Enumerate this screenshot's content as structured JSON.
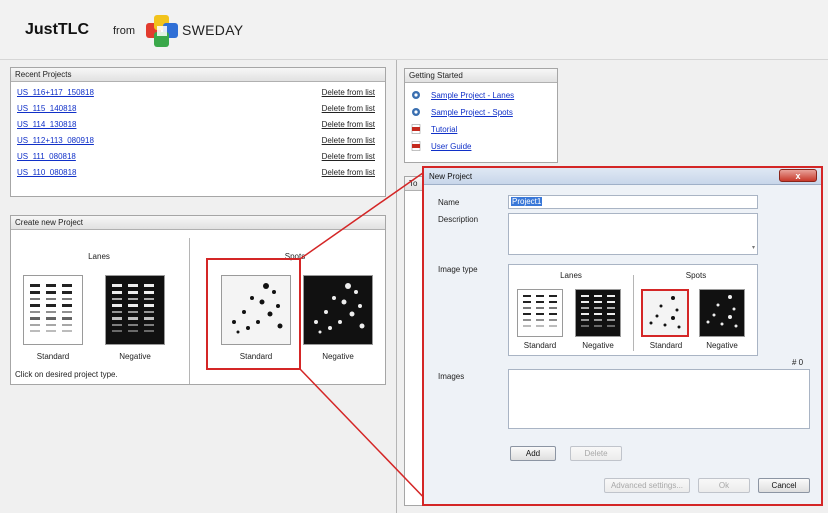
{
  "header": {
    "app_title": "JustTLC",
    "from_label": "from",
    "company": "SWEDAY"
  },
  "recent_projects": {
    "title": "Recent Projects",
    "delete_label": "Delete from list",
    "items": [
      "US_116+117_150818",
      "US_115_140818",
      "US_114_130818",
      "US_112+113_080918",
      "US_111_080818",
      "US_110_080818"
    ]
  },
  "create_project": {
    "title": "Create new Project",
    "lanes_label": "Lanes",
    "spots_label": "Spots",
    "standard_label": "Standard",
    "negative_label": "Negative",
    "hint": "Click on desired project type."
  },
  "getting_started": {
    "title": "Getting Started",
    "items": [
      {
        "label": "Sample Project - Lanes",
        "icon": "sample-project-icon"
      },
      {
        "label": "Sample Project - Spots",
        "icon": "sample-project-icon"
      },
      {
        "label": "Tutorial",
        "icon": "pdf-icon"
      },
      {
        "label": "User Guide",
        "icon": "pdf-icon"
      }
    ]
  },
  "tips": {
    "title": "To"
  },
  "dialog": {
    "title": "New Project",
    "close_glyph": "x",
    "name_label": "Name",
    "name_value": "Project1",
    "description_label": "Description",
    "image_type_label": "Image type",
    "lanes_label": "Lanes",
    "spots_label": "Spots",
    "standard_label": "Standard",
    "negative_label": "Negative",
    "images_label": "Images",
    "images_count": "# 0",
    "add_button": "Add",
    "delete_button": "Delete",
    "advanced_button": "Advanced settings...",
    "ok_button": "Ok",
    "cancel_button": "Cancel"
  },
  "colors": {
    "link": "#1030c8",
    "highlight": "#d42626",
    "selection": "#3a78d8"
  }
}
